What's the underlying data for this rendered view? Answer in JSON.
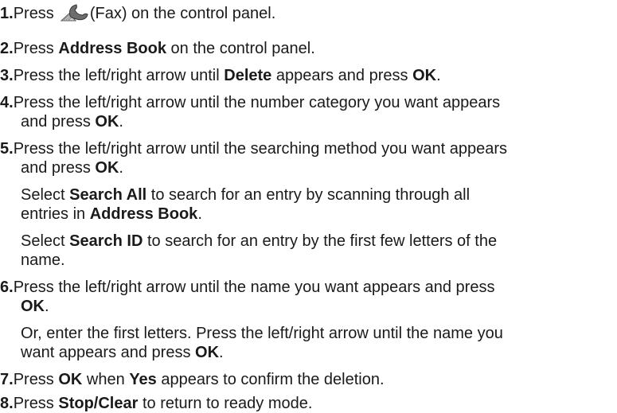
{
  "steps": [
    {
      "num": "1.",
      "lines": [
        {
          "pre": "Press",
          "post": "(Fax) on the control panel."
        }
      ],
      "icon": "fax-icon"
    },
    {
      "num": "2.",
      "lines": [
        {
          "t1": "Press ",
          "b1": "Address Book",
          "t2": " on the control panel."
        }
      ]
    },
    {
      "num": "3.",
      "lines": [
        {
          "t1": "Press the left/right arrow until ",
          "b1": "Delete",
          "t2": " appears and press ",
          "b2": "OK",
          "t3": "."
        }
      ]
    },
    {
      "num": "4.",
      "lines": [
        {
          "t1": "Press the left/right arrow until the number category you want appears"
        },
        {
          "t1": "and press ",
          "b1": "OK",
          "t2": "."
        }
      ]
    },
    {
      "num": "5.",
      "lines": [
        {
          "t1": "Press the left/right arrow until the searching method you want appears"
        },
        {
          "t1": "and press ",
          "b1": "OK",
          "t2": "."
        },
        {
          "t1": "Select ",
          "b1": "Search All",
          "t2": " to search for an entry by scanning through all"
        },
        {
          "t1": "entries in ",
          "b1": "Address Book",
          "t2": "."
        },
        {
          "t1": "Select ",
          "b1": "Search ID",
          "t2": " to search for an entry by the first few letters of the"
        },
        {
          "t1": "name."
        }
      ]
    },
    {
      "num": "6.",
      "lines": [
        {
          "t1": "Press the left/right arrow until the name you want appears and press"
        },
        {
          "b1": "OK",
          "t2": "."
        },
        {
          "t1": "Or, enter the first letters. Press the left/right arrow until the name you"
        },
        {
          "t1": "want appears and press ",
          "b1": "OK",
          "t2": "."
        }
      ]
    },
    {
      "num": "7.",
      "lines": [
        {
          "t1": "Press ",
          "b1": "OK",
          "t2": " when ",
          "b2": "Yes",
          "t3": " appears to confirm the deletion."
        }
      ]
    },
    {
      "num": "8.",
      "lines": [
        {
          "t1": "Press ",
          "b1": "Stop/Clear",
          "t2": " to return to ready mode."
        }
      ]
    }
  ]
}
